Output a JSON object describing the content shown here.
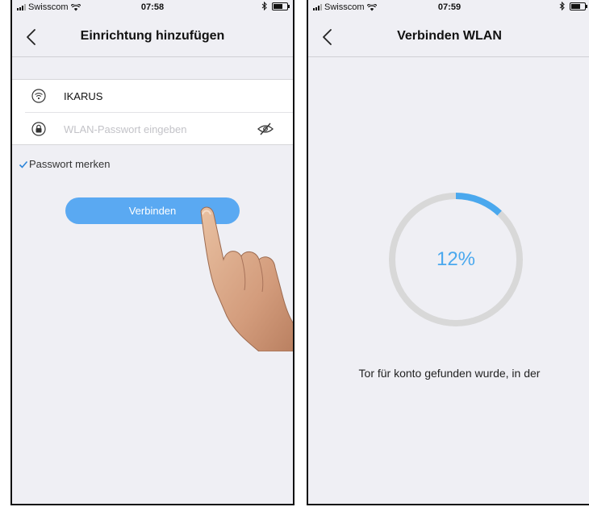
{
  "left_screen": {
    "status": {
      "carrier": "Swisscom",
      "time": "07:58"
    },
    "nav": {
      "title": "Einrichtung hinzufügen"
    },
    "wifi": {
      "ssid": "IKARUS",
      "password_placeholder": "WLAN-Passwort eingeben"
    },
    "remember_label": "Passwort merken",
    "remember_checked": true,
    "connect_label": "Verbinden"
  },
  "right_screen": {
    "status": {
      "carrier": "Swisscom",
      "time": "07:59"
    },
    "nav": {
      "title": "Verbinden WLAN"
    },
    "progress": {
      "percent": 12,
      "label": "12%"
    },
    "message": "Tor für konto gefunden wurde, in der"
  },
  "colors": {
    "accent": "#5aa9f2",
    "progress_fg": "#4aa8ee",
    "progress_track": "#d8d8d8",
    "background": "#efeff4"
  },
  "icons": {
    "wifi": "wifi-icon",
    "lock": "lock-icon",
    "eye_hidden": "eye-hidden-icon",
    "check": "check-icon",
    "back": "chevron-left-icon",
    "bluetooth": "bluetooth-icon",
    "battery": "battery-icon"
  }
}
